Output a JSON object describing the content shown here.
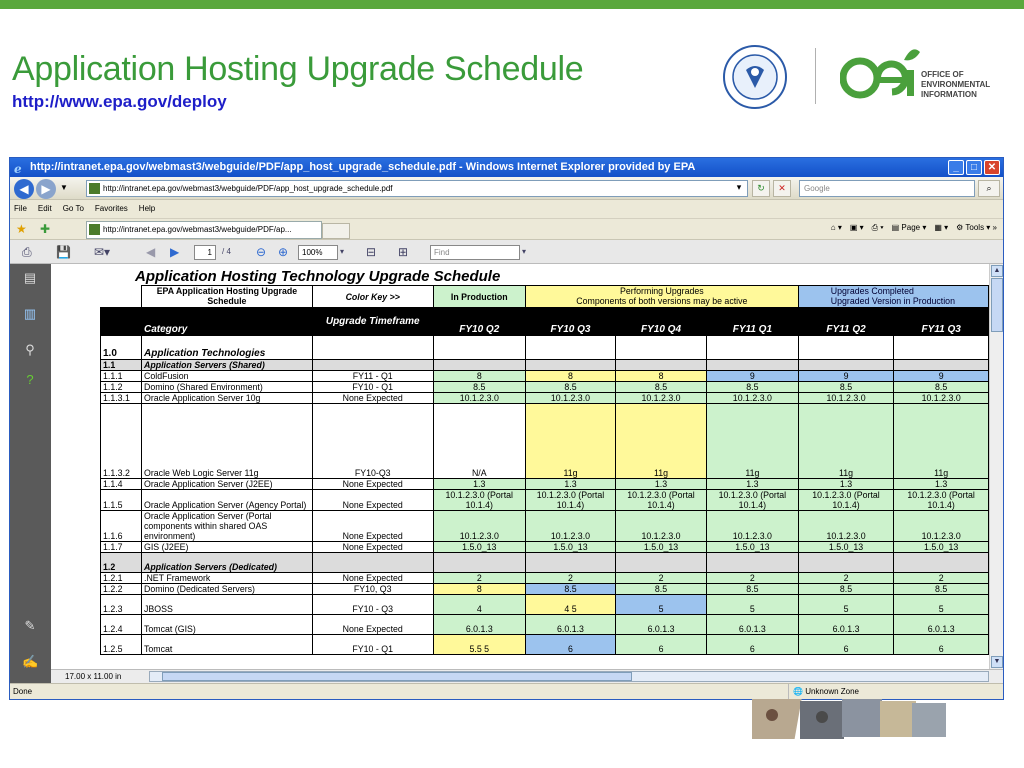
{
  "slide": {
    "title": "Application Hosting Upgrade Schedule",
    "link": "http://www.epa.gov/deploy",
    "oei_lines": [
      "OFFICE OF",
      "ENVIRONMENTAL",
      "INFORMATION"
    ]
  },
  "window": {
    "title": "http://intranet.epa.gov/webmast3/webguide/PDF/app_host_upgrade_schedule.pdf - Windows Internet Explorer provided by EPA",
    "address": "http://intranet.epa.gov/webmast3/webguide/PDF/app_host_upgrade_schedule.pdf",
    "search_placeholder": "Google",
    "menu": [
      "File",
      "Edit",
      "Go To",
      "Favorites",
      "Help"
    ],
    "tab_label": "http://intranet.epa.gov/webmast3/webguide/PDF/ap...",
    "page_label": "Page",
    "tools_label": "Tools",
    "status": "Done",
    "zone": "Unknown Zone"
  },
  "pdf": {
    "page_current": "1",
    "page_total": "/ 4",
    "zoom": "100%",
    "find_placeholder": "Find",
    "page_size": "17.00 x 11.00 in",
    "doc_title": "Application Hosting Technology Upgrade Schedule"
  },
  "table": {
    "legend": {
      "epa": "EPA Application Hosting Upgrade Schedule",
      "color_key": "Color Key >>",
      "in_production": "In Production",
      "performing_title": "Performing Upgrades",
      "performing_sub": "Components of both versions may be active",
      "complete_title": "Upgrades Completed",
      "complete_sub": "Upgraded Version in Production"
    },
    "header": {
      "category": "Category",
      "timeframe": "Upgrade Timeframe",
      "quarters": [
        "FY10 Q2",
        "FY10 Q3",
        "FY10 Q4",
        "FY11 Q1",
        "FY11 Q2",
        "FY11 Q3"
      ]
    },
    "rows": [
      {
        "id": "1.0",
        "name": "Application Technologies",
        "section": true,
        "big": true
      },
      {
        "id": "1.1",
        "name": "Application Servers (Shared)",
        "section": true
      },
      {
        "id": "1.1.1",
        "name": "ColdFusion",
        "tf": "FY11 - Q1",
        "v": [
          "8",
          "8",
          "8",
          "9",
          "9",
          "9"
        ],
        "c": [
          "g",
          "y",
          "y",
          "b",
          "b",
          "b"
        ]
      },
      {
        "id": "1.1.2",
        "name": "Domino (Shared Environment)",
        "tf": "FY10 - Q1",
        "v": [
          "8.5",
          "8.5",
          "8.5",
          "8.5",
          "8.5",
          "8.5"
        ],
        "c": [
          "g",
          "g",
          "g",
          "g",
          "g",
          "g"
        ]
      },
      {
        "id": "1.1.3.1",
        "name": "Oracle Application Server 10g",
        "tf": "None Expected",
        "v": [
          "10.1.2.3.0",
          "10.1.2.3.0",
          "10.1.2.3.0",
          "10.1.2.3.0",
          "10.1.2.3.0",
          "10.1.2.3.0"
        ],
        "c": [
          "g",
          "g",
          "g",
          "g",
          "g",
          "g"
        ]
      },
      {
        "id": "1.1.3.2",
        "name": "Oracle Web Logic Server 11g",
        "tf": "FY10-Q3",
        "v": [
          "N/A",
          "11g",
          "11g",
          "11g",
          "11g",
          "11g"
        ],
        "c": [
          "w",
          "y",
          "y",
          "g",
          "g",
          "g"
        ],
        "tall": true
      },
      {
        "id": "1.1.4",
        "name": "Oracle Application Server (J2EE)",
        "tf": "None Expected",
        "v": [
          "1.3",
          "1.3",
          "1.3",
          "1.3",
          "1.3",
          "1.3"
        ],
        "c": [
          "g",
          "g",
          "g",
          "g",
          "g",
          "g"
        ]
      },
      {
        "id": "1.1.5",
        "name": "Oracle Application Server (Agency Portal)",
        "tf": "None Expected",
        "v": [
          "10.1.2.3.0 (Portal 10.1.4)",
          "10.1.2.3.0 (Portal 10.1.4)",
          "10.1.2.3.0 (Portal 10.1.4)",
          "10.1.2.3.0 (Portal 10.1.4)",
          "10.1.2.3.0 (Portal 10.1.4)",
          "10.1.2.3.0 (Portal 10.1.4)"
        ],
        "c": [
          "g",
          "g",
          "g",
          "g",
          "g",
          "g"
        ],
        "rows": 2
      },
      {
        "id": "1.1.6",
        "name": "Oracle Application Server (Portal components within shared OAS environment)",
        "tf": "None Expected",
        "v": [
          "10.1.2.3.0",
          "10.1.2.3.0",
          "10.1.2.3.0",
          "10.1.2.3.0",
          "10.1.2.3.0",
          "10.1.2.3.0"
        ],
        "c": [
          "g",
          "g",
          "g",
          "g",
          "g",
          "g"
        ],
        "rows": 3
      },
      {
        "id": "1.1.7",
        "name": "GIS (J2EE)",
        "tf": "None Expected",
        "v": [
          "1.5.0_13",
          "1.5.0_13",
          "1.5.0_13",
          "1.5.0_13",
          "1.5.0_13",
          "1.5.0_13"
        ],
        "c": [
          "g",
          "g",
          "g",
          "g",
          "g",
          "g"
        ]
      },
      {
        "id": "1.2",
        "name": "Application Servers (Dedicated)",
        "section": true,
        "gap": true
      },
      {
        "id": "1.2.1",
        "name": ".NET Framework",
        "tf": "None Expected",
        "v": [
          "2",
          "2",
          "2",
          "2",
          "2",
          "2"
        ],
        "c": [
          "g",
          "g",
          "g",
          "g",
          "g",
          "g"
        ]
      },
      {
        "id": "1.2.2",
        "name": "Domino (Dedicated Servers)",
        "tf": "FY10, Q3",
        "v": [
          "8",
          "8.5",
          "8.5",
          "8.5",
          "8.5",
          "8.5"
        ],
        "c": [
          "y",
          "b",
          "g",
          "g",
          "g",
          "g"
        ]
      },
      {
        "id": "1.2.3",
        "name": "JBOSS",
        "tf": "FY10 - Q3",
        "v": [
          "4",
          "4 5",
          "5",
          "5",
          "5",
          "5"
        ],
        "c": [
          "g",
          "y",
          "b",
          "g",
          "g",
          "g"
        ],
        "rows": 2
      },
      {
        "id": "1.2.4",
        "name": "Tomcat (GIS)",
        "tf": "None Expected",
        "v": [
          "6.0.1.3",
          "6.0.1.3",
          "6.0.1.3",
          "6.0.1.3",
          "6.0.1.3",
          "6.0.1.3"
        ],
        "c": [
          "g",
          "g",
          "g",
          "g",
          "g",
          "g"
        ],
        "rows": 2
      },
      {
        "id": "1.2.5",
        "name": "Tomcat",
        "tf": "FY10 - Q1",
        "v": [
          "5.5 5",
          "6",
          "6",
          "6",
          "6",
          "6"
        ],
        "c": [
          "y",
          "b",
          "g",
          "g",
          "g",
          "g"
        ],
        "rows": 2
      }
    ]
  }
}
